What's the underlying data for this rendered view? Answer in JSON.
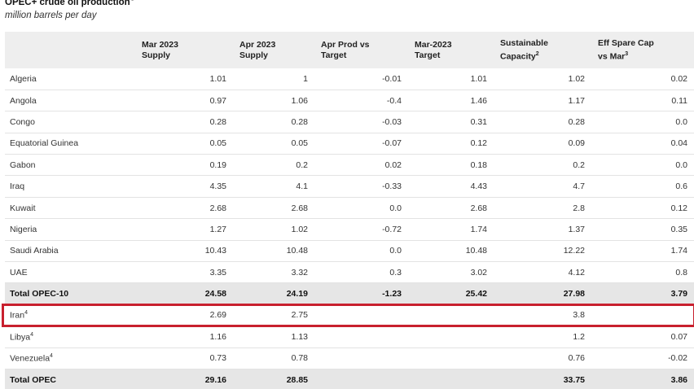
{
  "title": "OPEC+ crude oil production",
  "title_note": "1",
  "subtitle": "million barrels per day",
  "colors": {
    "highlight_border": "#c8202e",
    "header_bg": "#eeeeee",
    "total_row_bg": "#e6e6e6"
  },
  "highlighted_row": "Iran",
  "columns": [
    {
      "line1": "",
      "line2": "",
      "note": ""
    },
    {
      "line1": "Mar 2023",
      "line2": "Supply",
      "note": ""
    },
    {
      "line1": "Apr 2023",
      "line2": "Supply",
      "note": ""
    },
    {
      "line1": "Apr Prod vs",
      "line2": "Target",
      "note": ""
    },
    {
      "line1": "Mar-2023",
      "line2": "Target",
      "note": ""
    },
    {
      "line1": "Sustainable",
      "line2": "Capacity",
      "note": "2"
    },
    {
      "line1": "Eff Spare Cap",
      "line2": "vs Mar",
      "note": "3"
    }
  ],
  "rows": [
    {
      "name": "Algeria",
      "note": "",
      "total": false,
      "values": [
        "1.01",
        "1",
        "-0.01",
        "1.01",
        "1.02",
        "0.02"
      ]
    },
    {
      "name": "Angola",
      "note": "",
      "total": false,
      "values": [
        "0.97",
        "1.06",
        "-0.4",
        "1.46",
        "1.17",
        "0.11"
      ]
    },
    {
      "name": "Congo",
      "note": "",
      "total": false,
      "values": [
        "0.28",
        "0.28",
        "-0.03",
        "0.31",
        "0.28",
        "0.0"
      ]
    },
    {
      "name": "Equatorial Guinea",
      "note": "",
      "total": false,
      "values": [
        "0.05",
        "0.05",
        "-0.07",
        "0.12",
        "0.09",
        "0.04"
      ]
    },
    {
      "name": "Gabon",
      "note": "",
      "total": false,
      "values": [
        "0.19",
        "0.2",
        "0.02",
        "0.18",
        "0.2",
        "0.0"
      ]
    },
    {
      "name": "Iraq",
      "note": "",
      "total": false,
      "values": [
        "4.35",
        "4.1",
        "-0.33",
        "4.43",
        "4.7",
        "0.6"
      ]
    },
    {
      "name": "Kuwait",
      "note": "",
      "total": false,
      "values": [
        "2.68",
        "2.68",
        "0.0",
        "2.68",
        "2.8",
        "0.12"
      ]
    },
    {
      "name": "Nigeria",
      "note": "",
      "total": false,
      "values": [
        "1.27",
        "1.02",
        "-0.72",
        "1.74",
        "1.37",
        "0.35"
      ]
    },
    {
      "name": "Saudi Arabia",
      "note": "",
      "total": false,
      "values": [
        "10.43",
        "10.48",
        "0.0",
        "10.48",
        "12.22",
        "1.74"
      ]
    },
    {
      "name": "UAE",
      "note": "",
      "total": false,
      "values": [
        "3.35",
        "3.32",
        "0.3",
        "3.02",
        "4.12",
        "0.8"
      ]
    },
    {
      "name": "Total OPEC-10",
      "note": "",
      "total": true,
      "values": [
        "24.58",
        "24.19",
        "-1.23",
        "25.42",
        "27.98",
        "3.79"
      ]
    },
    {
      "name": "Iran",
      "note": "4",
      "total": false,
      "values": [
        "2.69",
        "2.75",
        "",
        "",
        "3.8",
        ""
      ]
    },
    {
      "name": "Libya",
      "note": "4",
      "total": false,
      "values": [
        "1.16",
        "1.13",
        "",
        "",
        "1.2",
        "0.07"
      ]
    },
    {
      "name": "Venezuela",
      "note": "4",
      "total": false,
      "values": [
        "0.73",
        "0.78",
        "",
        "",
        "0.76",
        "-0.02"
      ]
    },
    {
      "name": "Total OPEC",
      "note": "",
      "total": true,
      "values": [
        "29.16",
        "28.85",
        "",
        "",
        "33.75",
        "3.86"
      ]
    }
  ]
}
